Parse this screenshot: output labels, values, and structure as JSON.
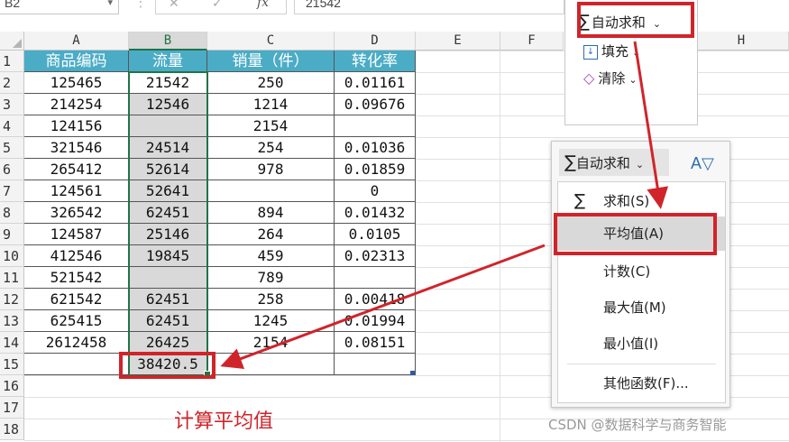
{
  "formula_bar": {
    "cell_ref": "B2",
    "fx_label": "fx",
    "value": "21542",
    "cancel_icon": "✕",
    "confirm_icon": "✓"
  },
  "columns": [
    "A",
    "B",
    "C",
    "D",
    "E",
    "F",
    "H"
  ],
  "rows": [
    "1",
    "2",
    "3",
    "4",
    "5",
    "6",
    "7",
    "8",
    "9",
    "10",
    "11",
    "12",
    "13",
    "14",
    "15",
    "16",
    "17",
    "18"
  ],
  "table": {
    "headers": [
      "商品编码",
      "流量",
      "销量（件）",
      "转化率"
    ],
    "data": [
      [
        "125465",
        "21542",
        "250",
        "0.01161"
      ],
      [
        "214254",
        "12546",
        "1214",
        "0.09676"
      ],
      [
        "124156",
        "",
        "2154",
        ""
      ],
      [
        "321546",
        "24514",
        "254",
        "0.01036"
      ],
      [
        "265412",
        "52614",
        "978",
        "0.01859"
      ],
      [
        "124561",
        "52641",
        "",
        "0"
      ],
      [
        "326542",
        "62451",
        "894",
        "0.01432"
      ],
      [
        "124587",
        "25146",
        "264",
        "0.0105"
      ],
      [
        "412546",
        "19845",
        "459",
        "0.02313"
      ],
      [
        "521542",
        "",
        "789",
        ""
      ],
      [
        "621542",
        "62451",
        "258",
        "0.00418"
      ],
      [
        "625415",
        "62451",
        "1245",
        "0.01994"
      ],
      [
        "2612458",
        "26425",
        "2154",
        "0.08151"
      ]
    ],
    "result": "38420.5"
  },
  "ribbon": {
    "autosum": "自动求和",
    "fill": "填充",
    "clear": "清除"
  },
  "dropdown": {
    "header": "自动求和",
    "items": [
      "求和(S)",
      "平均值(A)",
      "计数(C)",
      "最大值(M)",
      "最小值(I)",
      "其他函数(F)..."
    ]
  },
  "annotation": "计算平均值",
  "watermark": "CSDN @数据科学与商务智能",
  "colors": {
    "header_fill": "#4bacc6",
    "highlight_red": "#d0242a",
    "selection_green": "#217346"
  }
}
